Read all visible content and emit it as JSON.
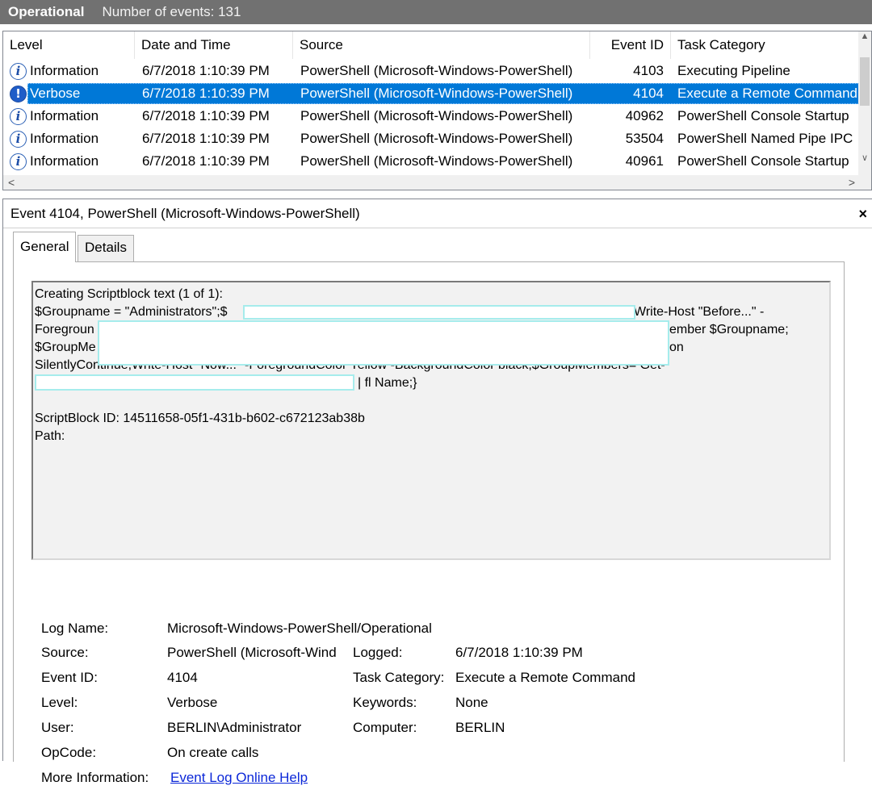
{
  "header": {
    "log_name": "Operational",
    "event_count": "Number of events: 131"
  },
  "list": {
    "columns": [
      "Level",
      "Date and Time",
      "Source",
      "Event ID",
      "Task Category"
    ],
    "rows": [
      {
        "level": "Information",
        "date": "6/7/2018 1:10:39 PM",
        "source": "PowerShell (Microsoft-Windows-PowerShell)",
        "event_id": "4103",
        "task": "Executing Pipeline"
      },
      {
        "level": "Verbose",
        "date": "6/7/2018 1:10:39 PM",
        "source": "PowerShell (Microsoft-Windows-PowerShell)",
        "event_id": "4104",
        "task": "Execute a Remote Command"
      },
      {
        "level": "Information",
        "date": "6/7/2018 1:10:39 PM",
        "source": "PowerShell (Microsoft-Windows-PowerShell)",
        "event_id": "40962",
        "task": "PowerShell Console Startup"
      },
      {
        "level": "Information",
        "date": "6/7/2018 1:10:39 PM",
        "source": "PowerShell (Microsoft-Windows-PowerShell)",
        "event_id": "53504",
        "task": "PowerShell Named Pipe IPC"
      },
      {
        "level": "Information",
        "date": "6/7/2018 1:10:39 PM",
        "source": "PowerShell (Microsoft-Windows-PowerShell)",
        "event_id": "40961",
        "task": "PowerShell Console Startup"
      }
    ],
    "selected_index": 1
  },
  "detail": {
    "title": "Event 4104, PowerShell (Microsoft-Windows-PowerShell)",
    "close_glyph": "×",
    "tabs": {
      "general": "General",
      "details": "Details"
    },
    "script_lines": [
      "Creating Scriptblock text (1 of 1):",
      "$Groupname = \"Administrators\";$",
      "Foregroun",
      "$GroupMe",
      "SilentlyContinue;Write-Host \"Now...\" -ForegroundColor Yellow -BackgroundColor black;$GroupMembers= Get-",
      "",
      "",
      "ScriptBlock ID: 14511658-05f1-431b-b602-c672123ab38b",
      "Path:"
    ],
    "script_fragments": {
      "line1_right": "Write-Host \"Before...\" -",
      "line2_right": "ember $Groupname;",
      "line3_right": "on",
      "line5_tail": "| fl Name;}"
    },
    "labels": {
      "log_name": "Log Name:",
      "source": "Source:",
      "event_id": "Event ID:",
      "level": "Level:",
      "user": "User:",
      "opcode": "OpCode:",
      "more_info": "More Information:",
      "logged": "Logged:",
      "task_category": "Task Category:",
      "keywords": "Keywords:",
      "computer": "Computer:"
    },
    "values": {
      "log_name": "Microsoft-Windows-PowerShell/Operational",
      "source": "PowerShell (Microsoft-Wind",
      "event_id": "4104",
      "level": "Verbose",
      "user": "BERLIN\\Administrator",
      "opcode": "On create calls",
      "more_info_link": "Event Log Online Help",
      "logged": "6/7/2018 1:10:39 PM",
      "task_category": "Execute a Remote Command",
      "keywords": "None",
      "computer": "BERLIN"
    }
  },
  "colors": {
    "header_bg": "#717171",
    "selection": "#0078d7",
    "redaction_border": "#a6ecec",
    "link": "#0b27d8"
  }
}
